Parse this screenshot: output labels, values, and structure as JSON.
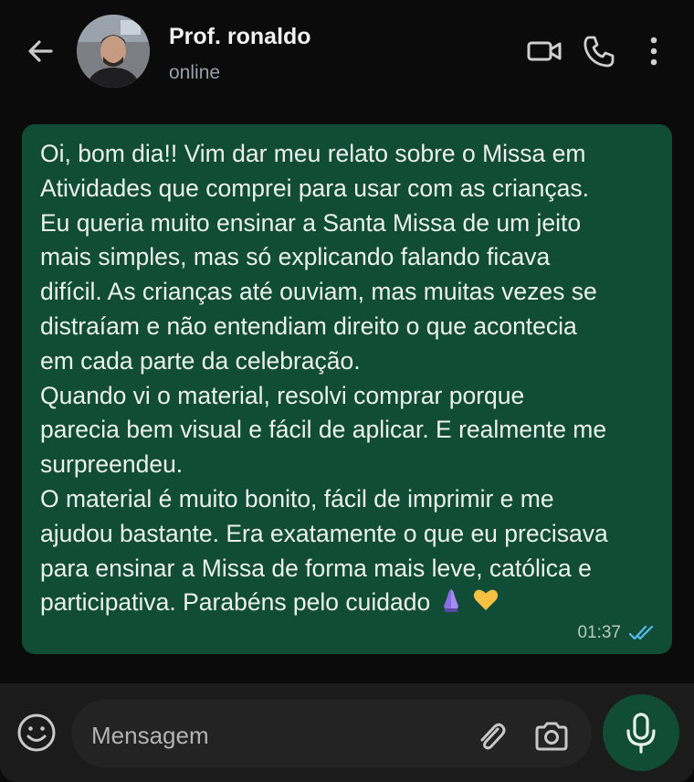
{
  "header": {
    "contact_name": "Prof. ronaldo",
    "status": "online",
    "icons": [
      "back-arrow-icon",
      "avatar",
      "video-call-icon",
      "voice-call-icon",
      "more-options-icon"
    ]
  },
  "message": {
    "lines": [
      "Oi, bom dia!! Vim dar meu relato sobre o Missa em",
      "Atividades que comprei para usar com as crianças.",
      "Eu queria muito ensinar a Santa Missa de um jeito",
      "mais simples, mas só explicando falando ficava",
      "difícil. As crianças até ouviam, mas muitas vezes se",
      "distraíam e não entendiam direito o que acontecia",
      "em cada parte da celebração.",
      "Quando vi o material, resolvi comprar porque",
      "parecia bem visual e fácil de aplicar. E realmente me",
      "surpreendeu.",
      "O material é muito bonito, fácil de imprimir e me",
      "ajudou bastante. Era exatamente o que eu precisava",
      "para ensinar a Missa de forma mais leve, católica e",
      "participativa. Parabéns pelo cuidado"
    ],
    "time": "01:37",
    "emojis": [
      "praying-hands-icon",
      "yellow-heart-icon"
    ],
    "read_receipt": "double-check-icon",
    "colors": {
      "bubble": "#114d36",
      "check": "#53bdeb"
    }
  },
  "composer": {
    "placeholder": "Mensagem",
    "icons": [
      "emoji-icon",
      "attach-icon",
      "camera-icon",
      "mic-icon"
    ]
  }
}
